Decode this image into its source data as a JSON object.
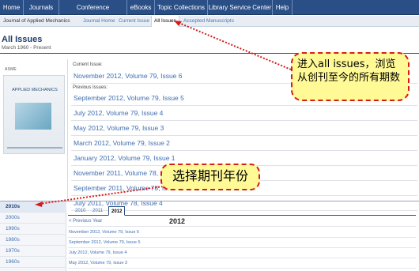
{
  "topnav": {
    "tabs": [
      "Home",
      "Journals",
      "Conference Proceedings",
      "eBooks",
      "Topic Collections",
      "Library Service Center",
      "Help"
    ]
  },
  "subnav": {
    "items": [
      "Journal of Applied Mechanics",
      "Journal Home",
      "Current Issue",
      "All Issues",
      "Accepted Manuscripts"
    ],
    "active": "All Issues"
  },
  "page": {
    "title": "All Issues",
    "subtitle": "March 1960 - Present"
  },
  "cover": {
    "brand": "ASME",
    "journal_title": "APPLIED MECHANICS"
  },
  "current": {
    "label": "Current Issue:",
    "issue": "November 2012, Volume 79, Issue 6"
  },
  "previous": {
    "label": "Previous Issues:",
    "issues": [
      "September 2012, Volume 79, Issue 5",
      "July 2012, Volume 79, Issue 4",
      "May 2012, Volume 79, Issue 3",
      "March 2012, Volume 79, Issue 2",
      "January 2012, Volume 79, Issue 1",
      "November 2011, Volume 78, Issue 6",
      "September 2011, Volume 78, Issue 5",
      "July 2011, Volume 78, Issue 4"
    ]
  },
  "decades": [
    "2010s",
    "2000s",
    "1990s",
    "1980s",
    "1970s",
    "1960s"
  ],
  "years": {
    "tabs": [
      "2010",
      "2011",
      "2012"
    ],
    "active": "2012",
    "prev_label": "< Previous Year",
    "heading": "2012"
  },
  "year_issues": [
    "November 2012, Volume 79, Issue 6",
    "September 2012, Volume 79, Issue 5",
    "July 2012, Volume 79, Issue 4",
    "May 2012, Volume 79, Issue 3"
  ],
  "annotations": {
    "callout1": "进入all issues，浏览从创刊至今的所有期数",
    "callout2": "选择期刊年份"
  },
  "colors": {
    "nav_blue": "#2a4f86",
    "link_blue": "#3f6fb1",
    "callout_bg": "#fffa96",
    "callout_border": "#d41c1c"
  }
}
